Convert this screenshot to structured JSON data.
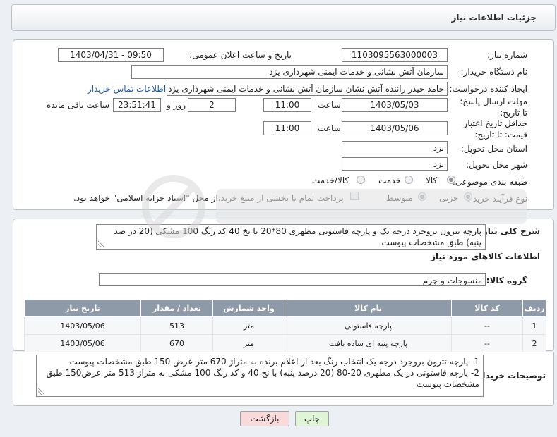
{
  "header": {
    "title": "جزئیات اطلاعات نیاز"
  },
  "form": {
    "need_number_label": "شماره نیاز:",
    "need_number": "1103095563000003",
    "announce_label": "تاریخ و ساعت اعلان عمومی:",
    "announce_value": "1403/04/31 - 09:50",
    "buyer_org_label": "نام دستگاه خریدار:",
    "buyer_org": "سازمان آتش نشانی و خدمات ایمنی شهرداری یزد",
    "requester_label": "ایجاد کننده درخواست:",
    "requester": "حامد حیدر راننده آتش نشان سازمان آتش نشانی و خدمات ایمنی شهرداری یزد",
    "contact_link": "اطلاعات تماس خریدار",
    "deadline_label": "مهلت ارسال پاسخ: تا تاریخ:",
    "deadline_date": "1403/05/03",
    "time_label": "ساعت",
    "deadline_time": "11:00",
    "days_value": "2",
    "days_label": "روز و",
    "remaining_time": "23:51:41",
    "remaining_label": "ساعت باقی مانده",
    "validity_label": "حداقل تاریخ اعتبار قیمت: تا تاریخ:",
    "validity_date": "1403/05/06",
    "validity_time": "11:00",
    "province_label": "استان محل تحویل:",
    "province": "یزد",
    "city_label": "شهر محل تحویل:",
    "city": "یزد",
    "category_label": "طبقه بندی موضوعی:",
    "category_options": [
      "کالا",
      "خدمت",
      "کالا/خدمت"
    ],
    "category_selected": "کالا",
    "process_label": "نوع فرآیند خرید :",
    "process_options": [
      "جزیی",
      "متوسط"
    ],
    "process_selected": "جزیی",
    "payment_note": "پرداخت تمام یا بخشی از مبلغ خرید،از محل \"اسناد خزانه اسلامی\" خواهد بود."
  },
  "description": {
    "label": "شرح کلی نیاز:",
    "text": "پارچه تترون بروجرد درجه یک و پارچه فاستونی مطهری 80*20 با نخ 40 کد رنگ 100 مشکی (20 در صد پنبه) طبق مشخصات پیوست"
  },
  "goods": {
    "section_title": "اطلاعات کالاهای مورد نیاز",
    "group_label": "گروه کالا:",
    "group_value": "منسوجات و چرم",
    "columns": [
      "ردیف",
      "کد کالا",
      "نام کالا",
      "واحد شمارش",
      "تعداد / مقدار",
      "تاریخ نیاز"
    ],
    "rows": [
      {
        "row": "1",
        "code": "--",
        "name": "پارچه فاستونی",
        "unit": "متر",
        "qty": "513",
        "date": "1403/05/06"
      },
      {
        "row": "2",
        "code": "--",
        "name": "پارچه پنبه ای ساده بافت",
        "unit": "متر",
        "qty": "670",
        "date": "1403/05/06"
      }
    ]
  },
  "buyer_notes": {
    "label": "توضیحات خریدار:",
    "line1": "1- پارچه تترون بروجرد درجه یک انتخاب رنگ بعد از اعلام برنده به متراژ 670 متر عرض 150 طبق مشخصات پیوست",
    "line2": "2- پارچه فاستونی در یک مطهری 20-80 (20 درصد پنبه) با نخ 40 و کد رنگ 100 مشکی به متراژ 513 متر عرض150 طبق مشخصات پیوست"
  },
  "buttons": {
    "print": "چاپ",
    "back": "بازگشت"
  },
  "colors": {
    "table_header": "#8e9aa8",
    "link": "#1a5db3",
    "print_button": "#dff5d6",
    "back_button": "#f8dada"
  }
}
